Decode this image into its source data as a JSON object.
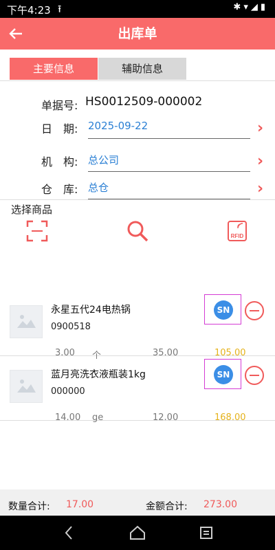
{
  "status_bar": {
    "time": "下午4:23",
    "upload_icon": "upload-icon",
    "icons": "bluetooth wifi signal battery"
  },
  "header": {
    "title": "出库单",
    "back_icon": "arrow-left-icon"
  },
  "tabs": [
    {
      "label": "主要信息",
      "active": true
    },
    {
      "label": "辅助信息",
      "active": false
    }
  ],
  "form": {
    "doc_no_label": "单据号:",
    "doc_no_value": "HS0012509-000002",
    "date_label": "日　期:",
    "date_value": "2025-09-22",
    "org_label": "机　构:",
    "org_value": "总公司",
    "warehouse_label": "仓　库:",
    "warehouse_value": "总仓"
  },
  "goods": {
    "section_title": "选择商品",
    "tools": [
      "scan-icon",
      "search-icon",
      "rfid-icon"
    ],
    "rfid_text": "RFID"
  },
  "items": [
    {
      "name": "永星五代24电热锅",
      "code": "0900518",
      "qty": "3.00",
      "unit": "个",
      "price": "35.00",
      "amount": "105.00",
      "sn": "SN"
    },
    {
      "name": "蓝月亮洗衣液瓶装1kg",
      "code": "000000",
      "qty": "14.00",
      "unit": "ge",
      "price": "12.00",
      "amount": "168.00",
      "sn": "SN"
    }
  ],
  "footer": {
    "qty_label": "数量合计:",
    "qty_value": "17.00",
    "amount_label": "金额合计:",
    "amount_value": "273.00"
  },
  "colors": {
    "accent": "#f96a6a",
    "link": "#2a7fd4",
    "amount": "#e5b21a",
    "sn_badge": "#3b8ee6"
  }
}
